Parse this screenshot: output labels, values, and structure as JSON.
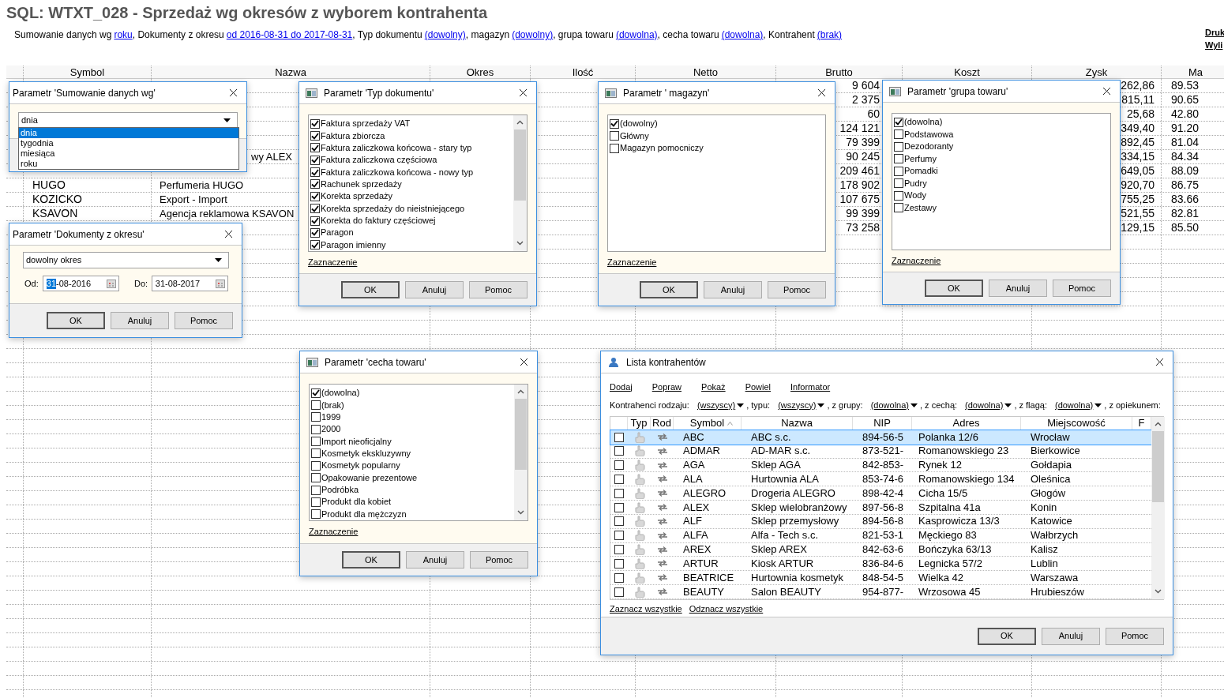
{
  "report": {
    "title": "SQL: WTXT_028 - Sprzedaż wg okresów z wyborem kontrahenta",
    "params": [
      {
        "label": "Sumowanie danych wg",
        "value": "roku"
      },
      {
        "label": ", Dokumenty z okresu",
        "value": "od 2016-08-31 do 2017-08-31"
      },
      {
        "label": ", Typ dokumentu",
        "value": "(dowolny)"
      },
      {
        "label": ", magazyn",
        "value": "(dowolny)"
      },
      {
        "label": ", grupa towaru",
        "value": "(dowolna)"
      },
      {
        "label": ", cecha towaru",
        "value": "(dowolna)"
      },
      {
        "label": ", Kontrahent",
        "value": "(brak)"
      }
    ],
    "side_links": [
      "Druk",
      "Wyli"
    ],
    "columns": [
      "Symbol",
      "Nazwa",
      "Okres",
      "Ilość",
      "Netto",
      "Brutto",
      "Koszt",
      "Zysk",
      "Ma"
    ],
    "rows": [
      {
        "kind": "data",
        "brutto": "9 604",
        "zysk": "262,86",
        "marza": "89.53"
      },
      {
        "kind": "data",
        "brutto": "2 375",
        "zysk": "815,11",
        "marza": "90.65"
      },
      {
        "kind": "data",
        "brutto": "60",
        "zysk": "25,68",
        "marza": "42.80"
      },
      {
        "kind": "data",
        "brutto": "124 121",
        "zysk": "349,40",
        "marza": "91.20"
      },
      {
        "kind": "data",
        "brutto": "79 399",
        "zysk": "892,45",
        "marza": "81.04"
      },
      {
        "kind": "tail",
        "nazwa": "wy  ALEX",
        "brutto": "90 245",
        "zysk": "334,15",
        "marza": "84.34"
      },
      {
        "kind": "data",
        "brutto": "209 461",
        "zysk": "649,05",
        "marza": "88.09"
      },
      {
        "kind": "data",
        "symbol": "HUGO",
        "nazwa": "Perfumeria HUGO",
        "brutto": "178 902",
        "zysk": "920,70",
        "marza": "86.75"
      },
      {
        "kind": "data",
        "symbol": "KOZICKO",
        "nazwa": "Export - Import",
        "brutto": "107 675",
        "zysk": "755,25",
        "marza": "83.66"
      },
      {
        "kind": "data",
        "symbol": "KSAVON",
        "nazwa": "Agencja reklamowa KSAVON",
        "brutto": "99 399",
        "zysk": "521,55",
        "marza": "82.81"
      },
      {
        "kind": "data",
        "brutto": "73 258",
        "zysk": "129,15",
        "marza": "85.50"
      }
    ]
  },
  "dialogs": [
    {
      "kind": "combo",
      "title": "Parametr 'Sumowanie danych wg'",
      "value": "dnia",
      "options": [
        {
          "label": "dnia",
          "selected": true
        },
        {
          "label": "tygodnia",
          "selected": false
        },
        {
          "label": "miesiąca",
          "selected": false
        },
        {
          "label": "roku",
          "selected": false
        }
      ]
    },
    {
      "kind": "checklist",
      "title": "Parametr 'Typ dokumentu'",
      "scrollbar": true,
      "items": [
        {
          "label": "Faktura sprzedaży VAT",
          "checked": true
        },
        {
          "label": "Faktura zbiorcza",
          "checked": true
        },
        {
          "label": "Faktura zaliczkowa końcowa - stary typ",
          "checked": true
        },
        {
          "label": "Faktura zaliczkowa częściowa",
          "checked": true
        },
        {
          "label": "Faktura zaliczkowa końcowa - nowy typ",
          "checked": true
        },
        {
          "label": "Rachunek sprzedaży",
          "checked": true
        },
        {
          "label": "Korekta sprzedaży",
          "checked": true
        },
        {
          "label": "Korekta sprzedaży do nieistniejącego",
          "checked": true
        },
        {
          "label": "Korekta do faktury częściowej",
          "checked": true
        },
        {
          "label": "Paragon",
          "checked": true
        },
        {
          "label": "Paragon imienny",
          "checked": true
        }
      ],
      "link": "Zaznaczenie",
      "buttons": [
        "OK",
        "Anuluj",
        "Pomoc"
      ]
    },
    {
      "kind": "checklist",
      "title": "Parametr ' magazyn'",
      "scrollbar": false,
      "items": [
        {
          "label": "(dowolny)",
          "checked": true
        },
        {
          "label": "Główny",
          "checked": false
        },
        {
          "label": "Magazyn pomocniczy",
          "checked": false
        }
      ],
      "link": "Zaznaczenie",
      "buttons": [
        "OK",
        "Anuluj",
        "Pomoc"
      ]
    },
    {
      "kind": "checklist",
      "title": "Parametr 'grupa towaru'",
      "scrollbar": false,
      "items": [
        {
          "label": "(dowolna)",
          "checked": true
        },
        {
          "label": "Podstawowa",
          "checked": false
        },
        {
          "label": "Dezodoranty",
          "checked": false
        },
        {
          "label": "Perfumy",
          "checked": false
        },
        {
          "label": "Pomadki",
          "checked": false
        },
        {
          "label": "Pudry",
          "checked": false
        },
        {
          "label": "Wody",
          "checked": false
        },
        {
          "label": "Zestawy",
          "checked": false
        }
      ],
      "link": "Zaznaczenie",
      "buttons": [
        "OK",
        "Anuluj",
        "Pomoc"
      ]
    },
    {
      "kind": "date",
      "title": "Parametr 'Dokumenty z okresu'",
      "value": "dowolny okres",
      "from": {
        "label": "Od:",
        "selected_part": "31",
        "rest": "-08-2016"
      },
      "to": {
        "label": "Do:",
        "value": "31-08-2017"
      },
      "buttons": [
        "OK",
        "Anuluj",
        "Pomoc"
      ]
    },
    {
      "kind": "checklist",
      "title": "Parametr 'cecha towaru'",
      "scrollbar": true,
      "items": [
        {
          "label": "(dowolna)",
          "checked": true
        },
        {
          "label": "(brak)",
          "checked": false
        },
        {
          "label": "1999",
          "checked": false
        },
        {
          "label": "2000",
          "checked": false
        },
        {
          "label": "Import nieoficjalny",
          "checked": false
        },
        {
          "label": "Kosmetyk ekskluzywny",
          "checked": false
        },
        {
          "label": "Kosmetyk popularny",
          "checked": false
        },
        {
          "label": "Opakowanie prezentowe",
          "checked": false
        },
        {
          "label": "Podróbka",
          "checked": false
        },
        {
          "label": "Produkt dla kobiet",
          "checked": false
        },
        {
          "label": "Produkt dla mężczyzn",
          "checked": false
        }
      ],
      "link": "Zaznaczenie",
      "buttons": [
        "OK",
        "Anuluj",
        "Pomoc"
      ]
    },
    {
      "kind": "contractors",
      "title": "Lista kontrahentów",
      "toolbar": [
        "Dodaj",
        "Popraw",
        "Pokaż",
        "Powiel",
        "Informator"
      ],
      "filters": [
        {
          "label": "Kontrahenci rodzaju:",
          "value": "(wszyscy)"
        },
        {
          "label": ", typu:",
          "value": "(wszyscy)"
        },
        {
          "label": ", z grupy:",
          "value": "(dowolna)"
        },
        {
          "label": ", z cechą:",
          "value": "(dowolna)"
        },
        {
          "label": ", z flagą:",
          "value": "(dowolna)"
        },
        {
          "label": ", z opiekunem:"
        }
      ],
      "columns": [
        {
          "label": "Typ",
          "sorted": false
        },
        {
          "label": "Rod",
          "sorted": false
        },
        {
          "label": "Symbol",
          "sorted": true
        },
        {
          "label": "Nazwa",
          "sorted": false
        },
        {
          "label": "NIP",
          "sorted": false
        },
        {
          "label": "Adres",
          "sorted": false
        },
        {
          "label": "Miejscowość",
          "sorted": false
        },
        {
          "label": "F",
          "sorted": false
        }
      ],
      "rows": [
        {
          "checked": false,
          "selected": true,
          "symbol": "ABC",
          "nazwa": "ABC s.c.",
          "nip": "894-56-5",
          "adres": "Polanka  12/6",
          "miasto": "Wrocław"
        },
        {
          "checked": false,
          "selected": false,
          "symbol": "ADMAR",
          "nazwa": "AD-MAR s.c.",
          "nip": "873-521-",
          "adres": "Romanowskiego 23",
          "miasto": "Bierkowice"
        },
        {
          "checked": false,
          "selected": false,
          "symbol": "AGA",
          "nazwa": "Sklep AGA",
          "nip": "842-853-",
          "adres": "Rynek 12",
          "miasto": "Gołdapia"
        },
        {
          "checked": false,
          "selected": false,
          "symbol": "ALA",
          "nazwa": "Hurtownia ALA",
          "nip": "853-74-6",
          "adres": "Romanowskiego 134",
          "miasto": "Oleśnica"
        },
        {
          "checked": false,
          "selected": false,
          "symbol": "ALEGRO",
          "nazwa": "Drogeria ALEGRO",
          "nip": "898-42-4",
          "adres": "Cicha  15/5",
          "miasto": "Głogów"
        },
        {
          "checked": false,
          "selected": false,
          "symbol": "ALEX",
          "nazwa": "Sklep wielobranżowy",
          "nip": "897-56-8",
          "adres": "Szpitalna  41a",
          "miasto": "Konin"
        },
        {
          "checked": false,
          "selected": false,
          "symbol": "ALF",
          "nazwa": "Sklep przemysłowy",
          "nip": "894-56-8",
          "adres": "Kasprowicza  13/3",
          "miasto": "Katowice"
        },
        {
          "checked": false,
          "selected": false,
          "symbol": "ALFA",
          "nazwa": "Alfa - Tech s.c.",
          "nip": "821-53-1",
          "adres": "Męckiego  83",
          "miasto": "Wałbrzych"
        },
        {
          "checked": false,
          "selected": false,
          "symbol": "AREX",
          "nazwa": "Sklep AREX",
          "nip": "842-63-6",
          "adres": "Bończyka  63/13",
          "miasto": "Kalisz"
        },
        {
          "checked": false,
          "selected": false,
          "symbol": "ARTUR",
          "nazwa": "Kiosk ARTUR",
          "nip": "836-84-6",
          "adres": "Legnicka  57/2",
          "miasto": "Lublin"
        },
        {
          "checked": false,
          "selected": false,
          "symbol": "BEATRICE",
          "nazwa": "Hurtownia kosmetyk",
          "nip": "848-54-5",
          "adres": "Wielka  42",
          "miasto": "Warszawa"
        },
        {
          "checked": false,
          "selected": false,
          "symbol": "BEAUTY",
          "nazwa": "Salon BEAUTY",
          "nip": "954-877-",
          "adres": "Wrzosowa  45",
          "miasto": "Hrubieszów"
        }
      ],
      "links": [
        "Zaznacz wszystkie",
        "Odznacz wszystkie"
      ],
      "buttons": [
        "OK",
        "Anuluj",
        "Pomoc"
      ]
    }
  ]
}
